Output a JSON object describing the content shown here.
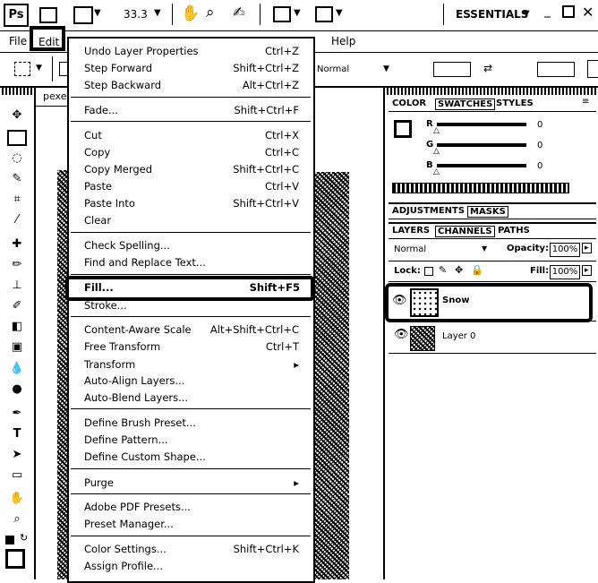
{
  "appbar": {
    "logo": "Ps",
    "zoom": "33.3",
    "workspace": "ESSENTIALS"
  },
  "menubar": {
    "file": "File",
    "edit": "Edit",
    "help": "Help"
  },
  "optionsbar": {
    "mode": "Normal"
  },
  "document": {
    "tab_label": "pexe"
  },
  "edit_menu": {
    "items": [
      {
        "label": "Undo Layer Properties",
        "shortcut": "Ctrl+Z"
      },
      {
        "label": "Step Forward",
        "shortcut": "Shift+Ctrl+Z"
      },
      {
        "label": "Step Backward",
        "shortcut": "Alt+Ctrl+Z"
      },
      {
        "label": "Fade...",
        "shortcut": "Shift+Ctrl+F"
      },
      {
        "label": "Cut",
        "shortcut": "Ctrl+X"
      },
      {
        "label": "Copy",
        "shortcut": "Ctrl+C"
      },
      {
        "label": "Copy Merged",
        "shortcut": "Shift+Ctrl+C"
      },
      {
        "label": "Paste",
        "shortcut": "Ctrl+V"
      },
      {
        "label": "Paste Into",
        "shortcut": "Shift+Ctrl+V"
      },
      {
        "label": "Clear",
        "shortcut": ""
      },
      {
        "label": "Check Spelling...",
        "shortcut": ""
      },
      {
        "label": "Find and Replace Text...",
        "shortcut": ""
      },
      {
        "label": "Fill...",
        "shortcut": "Shift+F5"
      },
      {
        "label": "Stroke...",
        "shortcut": ""
      },
      {
        "label": "Content-Aware Scale",
        "shortcut": "Alt+Shift+Ctrl+C"
      },
      {
        "label": "Free Transform",
        "shortcut": "Ctrl+T"
      },
      {
        "label": "Transform",
        "shortcut": ""
      },
      {
        "label": "Auto-Align Layers...",
        "shortcut": ""
      },
      {
        "label": "Auto-Blend Layers...",
        "shortcut": ""
      },
      {
        "label": "Define Brush Preset...",
        "shortcut": ""
      },
      {
        "label": "Define Pattern...",
        "shortcut": ""
      },
      {
        "label": "Define Custom Shape...",
        "shortcut": ""
      },
      {
        "label": "Purge",
        "shortcut": ""
      },
      {
        "label": "Adobe PDF Presets...",
        "shortcut": ""
      },
      {
        "label": "Preset Manager...",
        "shortcut": ""
      },
      {
        "label": "Color Settings...",
        "shortcut": "Shift+Ctrl+K"
      },
      {
        "label": "Assign Profile...",
        "shortcut": ""
      }
    ]
  },
  "color_panel": {
    "tabs": [
      "COLOR",
      "SWATCHES",
      "STYLES"
    ],
    "r_label": "R",
    "g_label": "G",
    "b_label": "B",
    "r": "0",
    "g": "0",
    "b": "0"
  },
  "adjust_panel": {
    "tabs": [
      "ADJUSTMENTS",
      "MASKS"
    ]
  },
  "layers_panel": {
    "tabs": [
      "LAYERS",
      "CHANNELS",
      "PATHS"
    ],
    "blend_mode": "Normal",
    "opacity_label": "Opacity:",
    "opacity": "100%",
    "lock_label": "Lock:",
    "fill_label": "Fill:",
    "fill": "100%",
    "layers": [
      {
        "name": "Snow"
      },
      {
        "name": "Layer 0"
      }
    ]
  },
  "colors": {
    "ink": "#000000",
    "paper": "#ffffff"
  }
}
